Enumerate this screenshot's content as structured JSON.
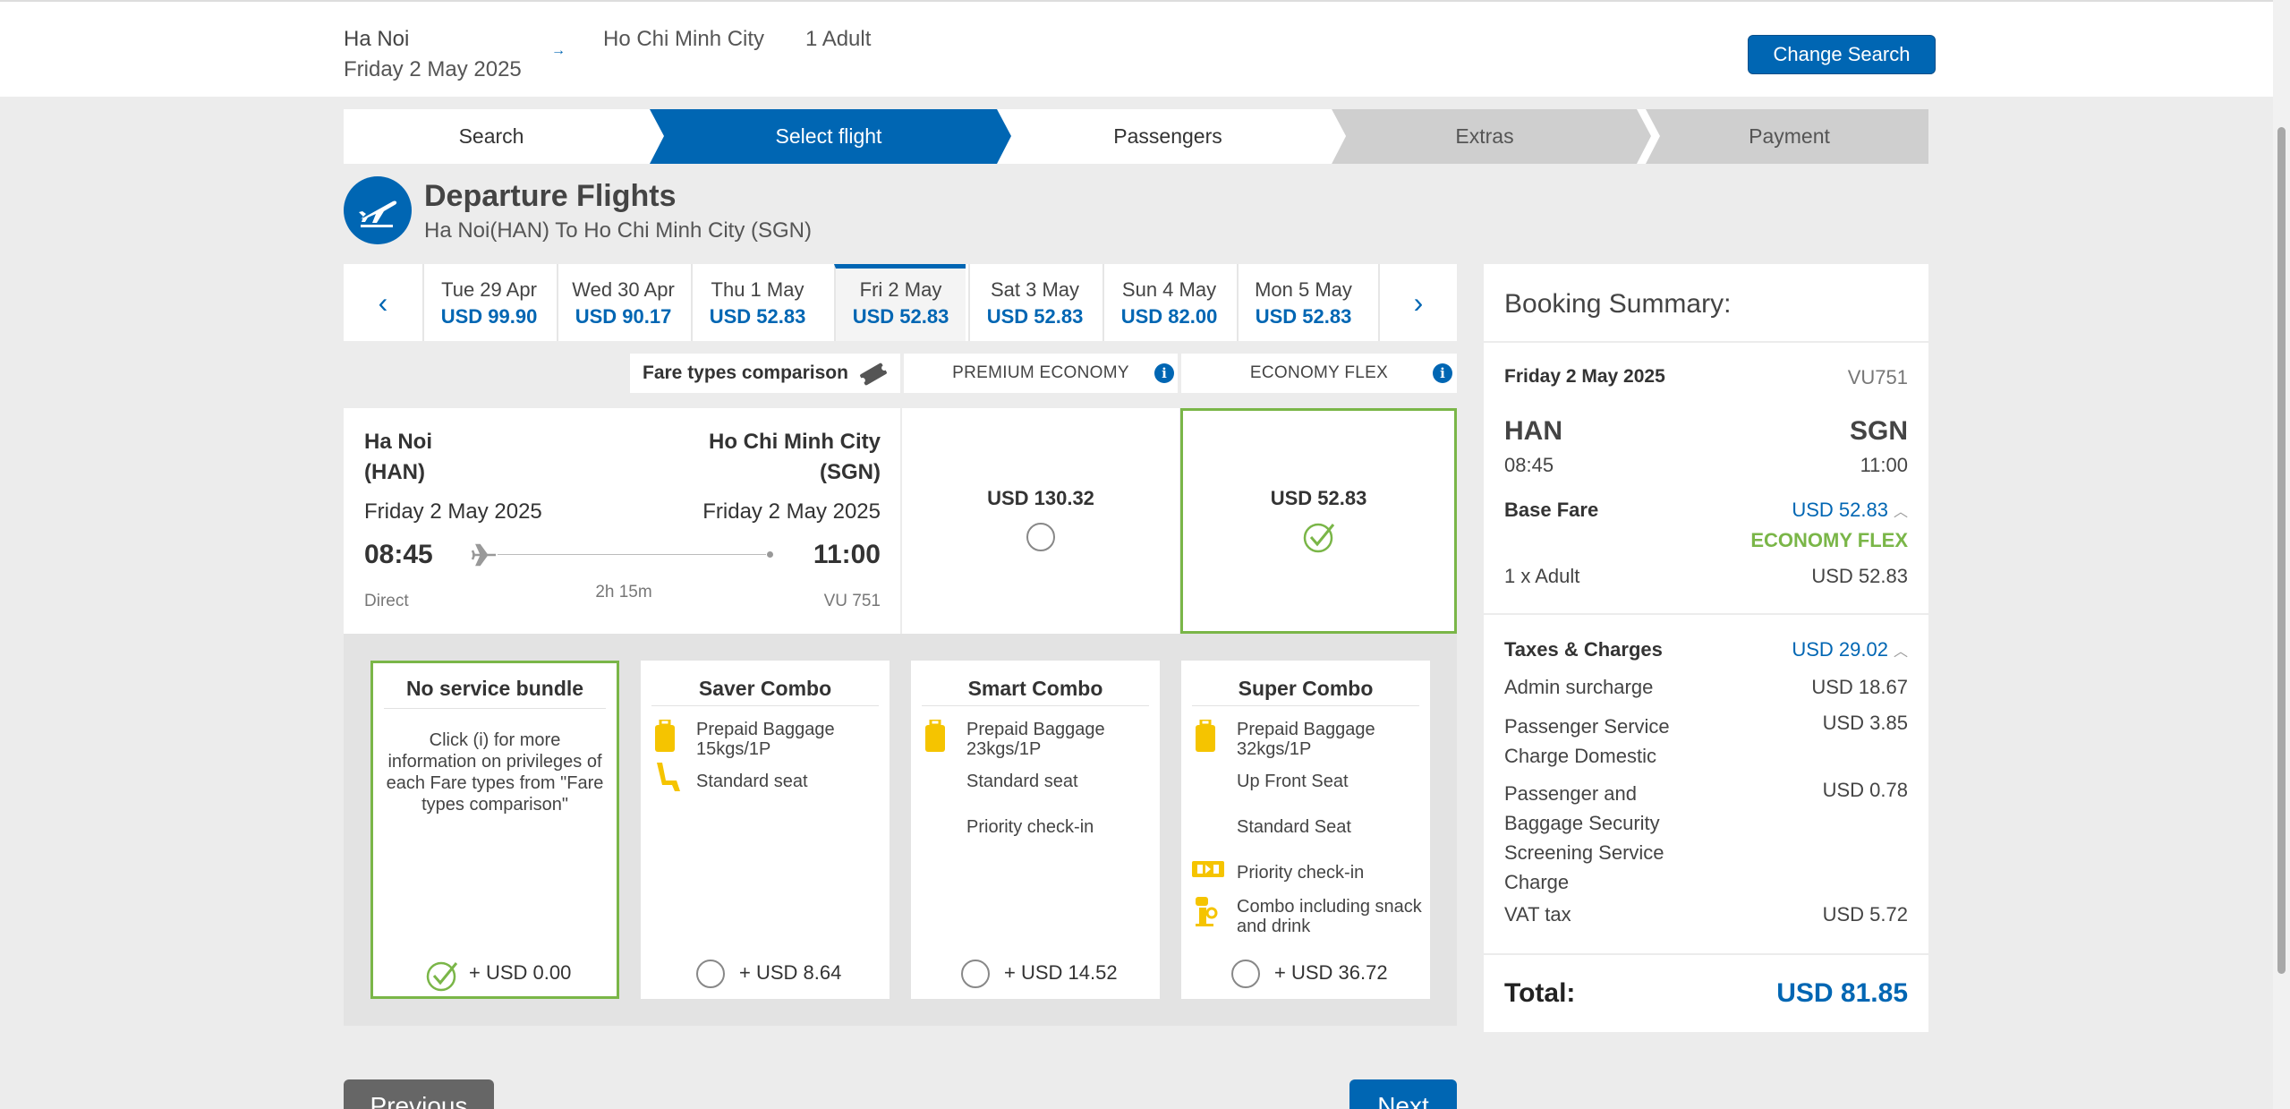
{
  "header": {
    "origin": "Ha Noi",
    "date": "Friday 2 May 2025",
    "arrow": "→",
    "destination": "Ho Chi Minh City",
    "passengers": "1 Adult",
    "change_search_label": "Change Search"
  },
  "steps": [
    {
      "label": "Search",
      "state": "done"
    },
    {
      "label": "Select flight",
      "state": "active"
    },
    {
      "label": "Passengers",
      "state": "upcoming"
    },
    {
      "label": "Extras",
      "state": "disabled"
    },
    {
      "label": "Payment",
      "state": "disabled"
    }
  ],
  "departure": {
    "title": "Departure Flights",
    "subtitle": "Ha Noi(HAN) To Ho Chi Minh City (SGN)"
  },
  "date_nav": {
    "prev": "‹",
    "next": "›",
    "dates": [
      {
        "label": "Tue 29 Apr",
        "price": "USD 99.90"
      },
      {
        "label": "Wed 30 Apr",
        "price": "USD 90.17"
      },
      {
        "label": "Thu 1 May",
        "price": "USD 52.83"
      },
      {
        "label": "Fri 2 May",
        "price": "USD 52.83",
        "selected": true
      },
      {
        "label": "Sat 3 May",
        "price": "USD 52.83"
      },
      {
        "label": "Sun 4 May",
        "price": "USD 82.00"
      },
      {
        "label": "Mon 5 May",
        "price": "USD 52.83"
      }
    ]
  },
  "fare_types": {
    "label": "Fare types comparison",
    "premium": "PREMIUM ECONOMY",
    "flex": "ECONOMY FLEX",
    "info": "i"
  },
  "flight": {
    "from_city": "Ha Noi",
    "from_code": "(HAN)",
    "to_city": "Ho Chi Minh City",
    "to_code": "(SGN)",
    "dep_date": "Friday 2 May 2025",
    "arr_date": "Friday 2 May 2025",
    "dep_time": "08:45",
    "arr_time": "11:00",
    "duration": "2h 15m",
    "stops": "Direct",
    "flight_no": "VU 751"
  },
  "fares": {
    "premium_price": "USD 130.32",
    "flex_price": "USD 52.83",
    "selected": "flex"
  },
  "bundles": [
    {
      "title": "No service bundle",
      "desc": "Click (i) for more information on privileges of each Fare types from \"Fare types comparison\"",
      "price": "+ USD 0.00",
      "selected": true
    },
    {
      "title": "Saver Combo",
      "items": [
        "Prepaid Baggage 15kgs/1P",
        "Standard seat"
      ],
      "price": "+ USD 8.64"
    },
    {
      "title": "Smart Combo",
      "items": [
        "Prepaid Baggage 23kgs/1P",
        "Standard seat",
        "Priority check-in"
      ],
      "price": "+ USD 14.52"
    },
    {
      "title": "Super Combo",
      "items": [
        "Prepaid Baggage 32kgs/1P",
        "Up Front Seat",
        "Standard Seat",
        "Priority check-in",
        "Combo including snack and drink"
      ],
      "price": "+ USD 36.72"
    }
  ],
  "summary": {
    "title": "Booking Summary:",
    "date": "Friday 2 May 2025",
    "flight_no": "VU751",
    "from_code": "HAN",
    "to_code": "SGN",
    "dep_time": "08:45",
    "arr_time": "11:00",
    "base_fare_label": "Base Fare",
    "base_fare": "USD 52.83",
    "fare_type": "ECONOMY FLEX",
    "adult_label": "1 x Adult",
    "adult_price": "USD 52.83",
    "taxes_label": "Taxes & Charges",
    "taxes_total": "USD 29.02",
    "taxes": [
      {
        "label": "Admin surcharge",
        "value": "USD 18.67"
      },
      {
        "label": "Passenger Service Charge Domestic",
        "value": "USD 3.85"
      },
      {
        "label": "Passenger and Baggage Security Screening Service Charge",
        "value": "USD 0.78"
      },
      {
        "label": "VAT tax",
        "value": "USD 5.72"
      }
    ],
    "total_label": "Total:",
    "total": "USD 81.85"
  },
  "footer": {
    "previous_label": "Previous",
    "next_label": "Next"
  },
  "colors": {
    "brand_blue": "#0066b3",
    "selected_green": "#7ab648",
    "baggage_yellow": "#f5c400"
  }
}
